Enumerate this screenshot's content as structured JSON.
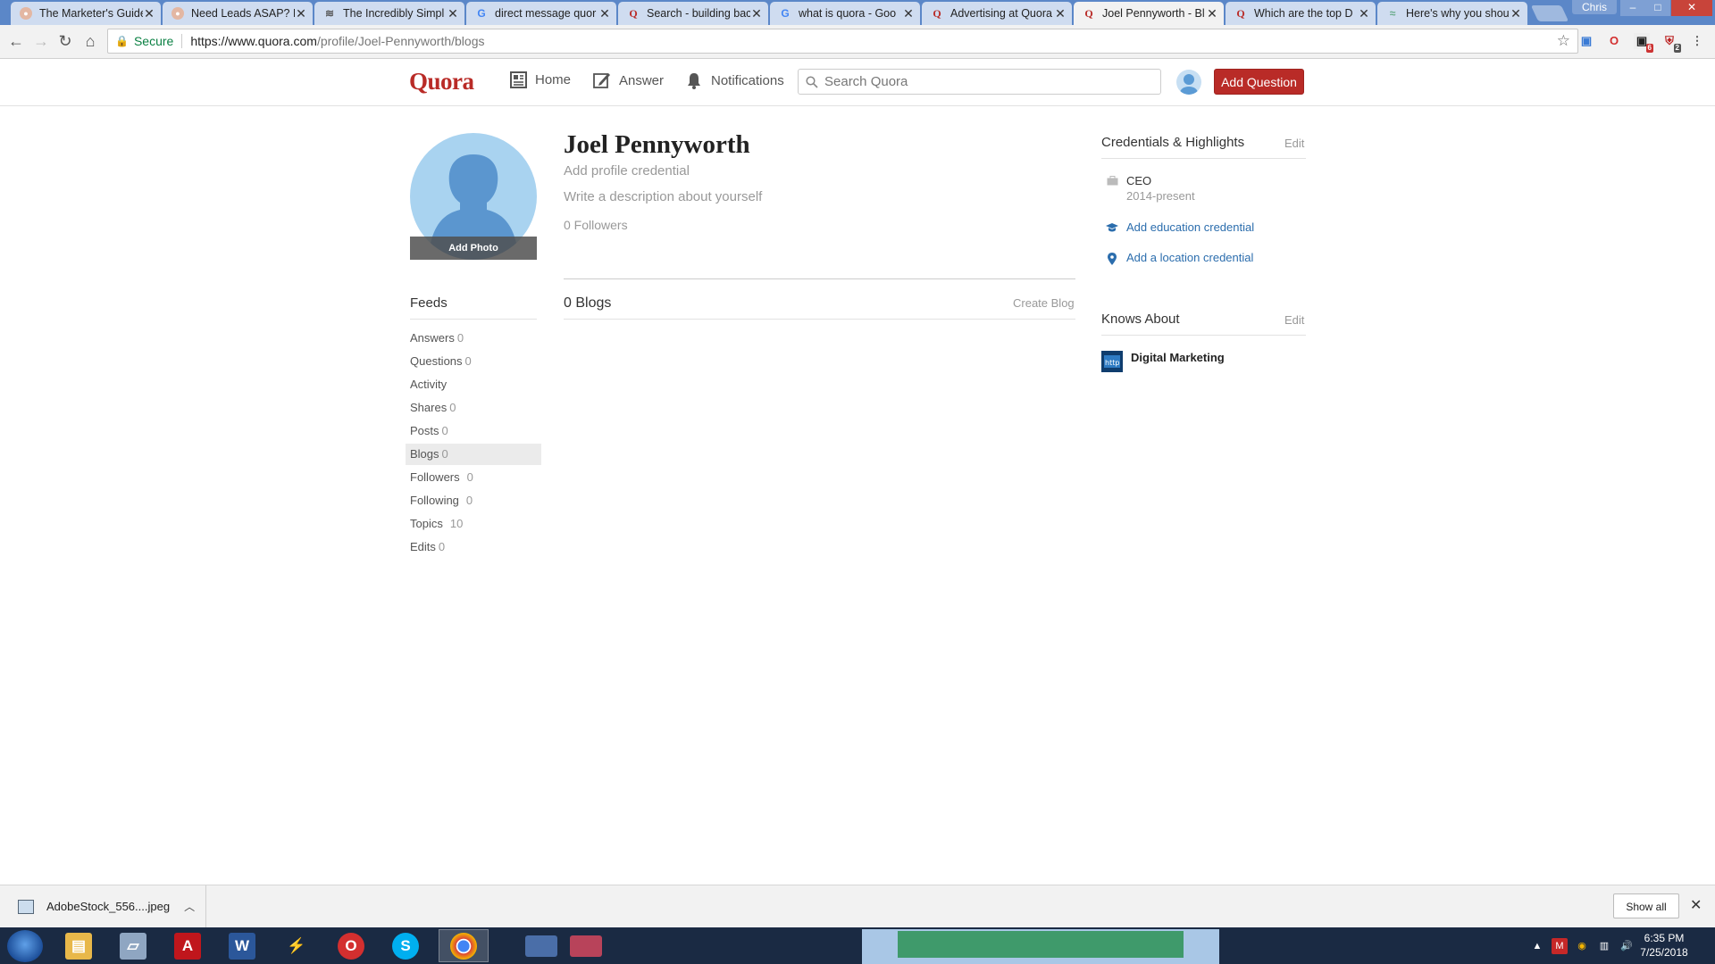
{
  "browser": {
    "tabs": [
      {
        "title": "The Marketer's Guide",
        "icon": "avatar-icon",
        "active": false
      },
      {
        "title": "Need Leads ASAP? H",
        "icon": "avatar-icon",
        "active": false
      },
      {
        "title": "The Incredibly Simpl",
        "icon": "stack-icon",
        "active": false
      },
      {
        "title": "direct message quor",
        "icon": "google-icon",
        "active": false
      },
      {
        "title": "Search - building bac",
        "icon": "quora-icon",
        "active": false
      },
      {
        "title": "what is quora - Goo",
        "icon": "google-icon",
        "active": false
      },
      {
        "title": "Advertising at Quora",
        "icon": "quora-icon",
        "active": false
      },
      {
        "title": "Joel Pennyworth - Bl",
        "icon": "quora-icon",
        "active": true
      },
      {
        "title": "Which are the top D",
        "icon": "quora-icon",
        "active": false
      },
      {
        "title": "Here's why you shou",
        "icon": "wifi-icon",
        "active": false
      }
    ],
    "user": "Chris",
    "secure_label": "Secure",
    "url_host": "https://www.quora.com",
    "url_path": "/profile/Joel-Pennyworth/blogs",
    "extension_badges": {
      "ext4": "6",
      "ext5": "2"
    }
  },
  "header": {
    "logo": "Quora",
    "nav": {
      "home": "Home",
      "answer": "Answer",
      "notifications": "Notifications"
    },
    "search_placeholder": "Search Quora",
    "add_question": "Add Question"
  },
  "profile": {
    "name": "Joel Pennyworth",
    "add_photo": "Add Photo",
    "credential_prompt": "Add profile credential",
    "description_prompt": "Write a description about yourself",
    "followers": "0 Followers"
  },
  "feeds": {
    "title": "Feeds",
    "items": [
      {
        "label": "Answers",
        "count": "0"
      },
      {
        "label": "Questions",
        "count": "0"
      },
      {
        "label": "Activity",
        "count": ""
      },
      {
        "label": "Shares",
        "count": "0"
      },
      {
        "label": "Posts",
        "count": "0"
      },
      {
        "label": "Blogs",
        "count": "0",
        "selected": true
      },
      {
        "label": "Followers",
        "count": "0"
      },
      {
        "label": "Following",
        "count": "0"
      },
      {
        "label": "Topics",
        "count": "10"
      },
      {
        "label": "Edits",
        "count": "0"
      }
    ]
  },
  "blogs": {
    "title": "0 Blogs",
    "create": "Create Blog"
  },
  "credentials": {
    "title": "Credentials & Highlights",
    "edit": "Edit",
    "employment_title": "CEO",
    "employment_years": "2014-present",
    "add_education": "Add education credential",
    "add_location": "Add a location credential"
  },
  "knows_about": {
    "title": "Knows About",
    "edit": "Edit",
    "topics": [
      "Digital Marketing"
    ]
  },
  "download_bar": {
    "file": "AdobeStock_556....jpeg",
    "show_all": "Show all"
  },
  "taskbar": {
    "time": "6:35 PM",
    "date": "7/25/2018"
  },
  "colors": {
    "quora_red": "#b92b27",
    "link_blue": "#2b6dad"
  }
}
